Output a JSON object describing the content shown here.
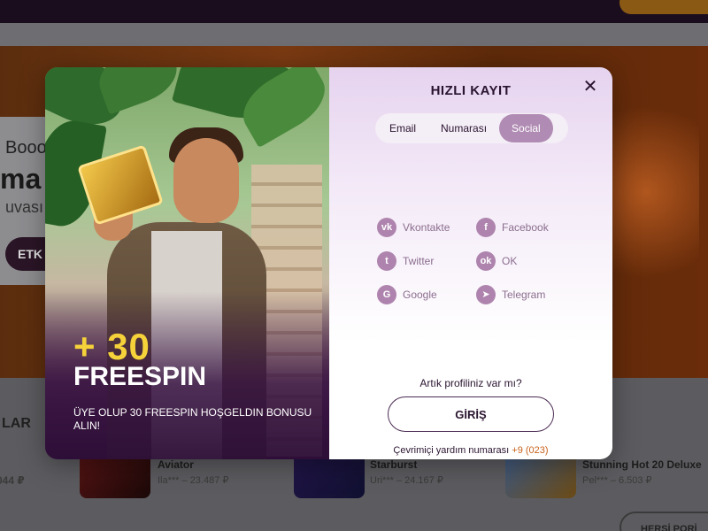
{
  "background": {
    "hero": {
      "line1": "Booo",
      "line2": "ma",
      "line3": "uvası",
      "button": "ETK"
    },
    "section_title": "LAR",
    "left_amount": "044 ₽",
    "games": [
      {
        "name": "Aviator",
        "amount": "Ila*** – 23.487 ₽"
      },
      {
        "name": "Starburst",
        "amount": "Uri*** – 24.167 ₽"
      },
      {
        "name": "Stunning Hot 20 Deluxe",
        "amount": "Pel*** – 6.503 ₽"
      }
    ],
    "view_all": "HERŞİ PORİ"
  },
  "promo": {
    "headline": "+ 30",
    "subheadline": "FREESPIN",
    "text": "ÜYE OLUP 30 FREESPIN HOŞGELDIN BONUSU ALIN!"
  },
  "form": {
    "title": "HIZLI KAYIT",
    "close": "✕",
    "tabs": [
      {
        "label": "Email",
        "active": false
      },
      {
        "label": "Numarası",
        "active": false
      },
      {
        "label": "Social",
        "active": true
      }
    ],
    "socials": [
      {
        "label": "Vkontakte",
        "icon": "vk-icon",
        "glyph": "vk"
      },
      {
        "label": "Facebook",
        "icon": "facebook-icon",
        "glyph": "f"
      },
      {
        "label": "Twitter",
        "icon": "twitter-icon",
        "glyph": "t"
      },
      {
        "label": "OK",
        "icon": "odnoklassniki-icon",
        "glyph": "ok"
      },
      {
        "label": "Google",
        "icon": "google-icon",
        "glyph": "G"
      },
      {
        "label": "Telegram",
        "icon": "telegram-icon",
        "glyph": "➤"
      }
    ],
    "question": "Artık profiliniz var mı?",
    "login_button": "GİRİŞ",
    "help_text": "Çevrimiçi yardım numarası",
    "help_number": "+9 (023)"
  },
  "colors": {
    "accent": "#b08bb3",
    "title": "#2a1430",
    "promo_yellow": "#f5d23a",
    "help_number": "#c8621a"
  }
}
